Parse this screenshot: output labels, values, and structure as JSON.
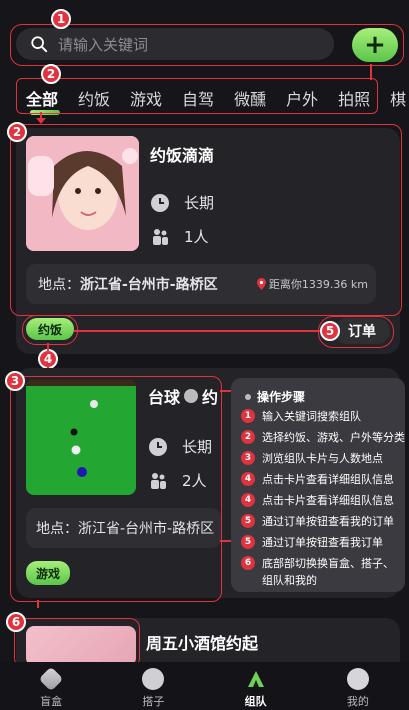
{
  "search": {
    "placeholder": "请输入关键词",
    "add_label": "+"
  },
  "tabs": [
    {
      "label": "全部"
    },
    {
      "label": "约饭"
    },
    {
      "label": "游戏"
    },
    {
      "label": "自驾"
    },
    {
      "label": "微醺"
    },
    {
      "label": "户外"
    },
    {
      "label": "拍照"
    },
    {
      "label": "棋"
    }
  ],
  "cards": [
    {
      "title": "约饭滴滴",
      "duration": "长期",
      "people": "1人",
      "location_label": "地点：",
      "location": "浙江省-台州市-路桥区",
      "distance": "距离你1339.36 km",
      "tag": "约饭",
      "order_label": "订单"
    },
    {
      "title": "台球",
      "title_suffix": "约",
      "duration": "长期",
      "people": "2人",
      "location_label": "地点：",
      "location": "浙江省-台州市-路桥区",
      "tag": "游戏"
    },
    {
      "title": "周五小酒馆约起"
    }
  ],
  "annotations": [
    "1",
    "2",
    "2",
    "3",
    "4",
    "5",
    "6"
  ],
  "steps": {
    "title": "操作步骤",
    "items": [
      {
        "num": "1",
        "text": "输入关键词搜索组队"
      },
      {
        "num": "2",
        "text": "选择约饭、游戏、户外等分类"
      },
      {
        "num": "3",
        "text": "浏览组队卡片与人数地点"
      },
      {
        "num": "4",
        "text": "点击卡片查看详细组队信息"
      },
      {
        "num": "4",
        "text": "点击卡片查看详细组队信息"
      },
      {
        "num": "5",
        "text": "通过订单按钮查看我的订单"
      },
      {
        "num": "5",
        "text": "通过订单按钮查看我订单"
      },
      {
        "num": "6",
        "text": "底部部切换换盲盒、搭子、组队和我的"
      }
    ]
  },
  "nav": [
    {
      "label": "盲盒",
      "icon": "blindbox-icon"
    },
    {
      "label": "搭子",
      "icon": "partner-icon"
    },
    {
      "label": "组队",
      "icon": "team-icon",
      "active": true
    },
    {
      "label": "我的",
      "icon": "profile-icon"
    }
  ],
  "colors": {
    "accent": "#6fd155",
    "annotation": "#e0323f",
    "background": "#15151a",
    "card": "#232328"
  }
}
